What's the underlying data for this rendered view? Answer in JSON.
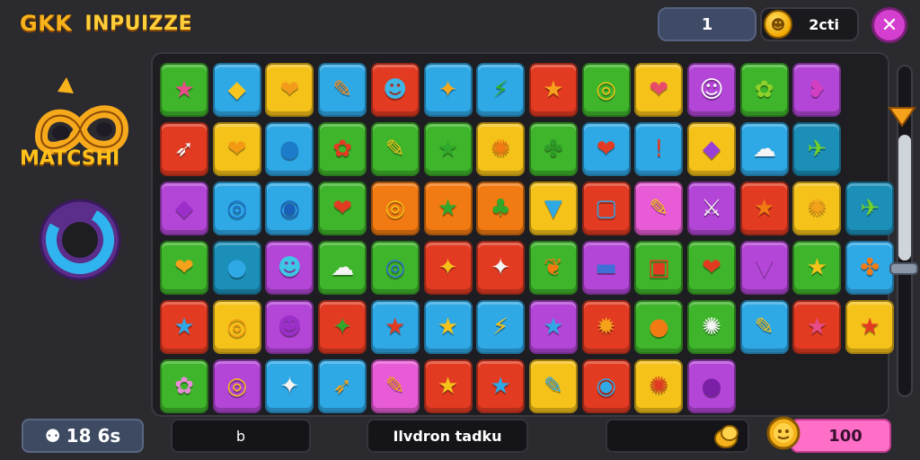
{
  "header": {
    "title_a": "GKK",
    "title_b": "INPUIZZE",
    "moves_value": "1",
    "coins_value": "2cti",
    "close_label": "✕"
  },
  "sidebar": {
    "logo_text": "MATCSHI"
  },
  "bottom": {
    "stats_value": "18 6s",
    "field_1": "b",
    "field_2": "Ilvdron tadku",
    "field_3": "",
    "reward_value": "100"
  },
  "colors": {
    "green": "#3fb52b",
    "blue": "#2fa8e6",
    "yellow": "#f5c21a",
    "red": "#e23b22",
    "orange": "#f27a12",
    "purple": "#b346d6",
    "pink": "#e85bd6",
    "teal": "#1c8fb8"
  },
  "board": {
    "rows": [
      [
        {
          "color": "green",
          "icon": "★",
          "glyph_color": "#e84b8a"
        },
        {
          "color": "blue",
          "icon": "◆",
          "glyph_color": "#f6c51f"
        },
        {
          "color": "yellow",
          "icon": "❤",
          "glyph_color": "#f39c1c"
        },
        {
          "color": "blue",
          "icon": "✎",
          "glyph_color": "#f48a1c"
        },
        {
          "color": "red",
          "icon": "☻",
          "glyph_color": "#3fb6e6"
        },
        {
          "color": "blue",
          "icon": "✦",
          "glyph_color": "#f5a81c"
        },
        {
          "color": "blue",
          "icon": "⚡",
          "glyph_color": "#2fb52b"
        },
        {
          "color": "red",
          "icon": "★",
          "glyph_color": "#f7a21c"
        },
        {
          "color": "green",
          "icon": "◎",
          "glyph_color": "#f5c21a"
        },
        {
          "color": "yellow",
          "icon": "❤",
          "glyph_color": "#e84b6a"
        },
        {
          "color": "purple",
          "icon": "☺",
          "glyph_color": "#ffffff"
        },
        {
          "color": "green",
          "icon": "✿",
          "glyph_color": "#8fd12a"
        },
        {
          "color": "purple",
          "icon": "❥",
          "glyph_color": "#d23fc2"
        }
      ],
      [
        {
          "color": "red",
          "icon": "➶",
          "glyph_color": "#f4f4f4"
        },
        {
          "color": "yellow",
          "icon": "❤",
          "glyph_color": "#f29a12"
        },
        {
          "color": "blue",
          "icon": "●",
          "glyph_color": "#1c7cc9"
        },
        {
          "color": "green",
          "icon": "✿",
          "glyph_color": "#e23b22"
        },
        {
          "color": "green",
          "icon": "✎",
          "glyph_color": "#f5c21a"
        },
        {
          "color": "green",
          "icon": "★",
          "glyph_color": "#2fa82b"
        },
        {
          "color": "yellow",
          "icon": "✺",
          "glyph_color": "#f27a12"
        },
        {
          "color": "green",
          "icon": "✤",
          "glyph_color": "#2e9a27"
        },
        {
          "color": "blue",
          "icon": "❤",
          "glyph_color": "#e23b22"
        },
        {
          "color": "blue",
          "icon": "ǃ",
          "glyph_color": "#e23b22"
        },
        {
          "color": "yellow",
          "icon": "◆",
          "glyph_color": "#9a3fd6"
        },
        {
          "color": "blue",
          "icon": "☁",
          "glyph_color": "#f4f4f4"
        },
        {
          "color": "teal",
          "icon": "✈",
          "glyph_color": "#6fd12a"
        }
      ],
      [
        {
          "color": "purple",
          "icon": "◆",
          "glyph_color": "#9a2fc9"
        },
        {
          "color": "blue",
          "icon": "◎",
          "glyph_color": "#1c6fc9"
        },
        {
          "color": "blue",
          "icon": "◉",
          "glyph_color": "#1c5fb8"
        },
        {
          "color": "green",
          "icon": "❤",
          "glyph_color": "#e23b22"
        },
        {
          "color": "orange",
          "icon": "◎",
          "glyph_color": "#f5c21a"
        },
        {
          "color": "orange",
          "icon": "★",
          "glyph_color": "#2fa82b"
        },
        {
          "color": "orange",
          "icon": "♣",
          "glyph_color": "#2fa82b"
        },
        {
          "color": "yellow",
          "icon": "▼",
          "glyph_color": "#2fa8e6"
        },
        {
          "color": "red",
          "icon": "▢",
          "glyph_color": "#2fa8e6"
        },
        {
          "color": "pink",
          "icon": "✎",
          "glyph_color": "#f5c21a"
        },
        {
          "color": "purple",
          "icon": "⚔",
          "glyph_color": "#f4f4f4"
        },
        {
          "color": "red",
          "icon": "★",
          "glyph_color": "#f27a12"
        },
        {
          "color": "yellow",
          "icon": "✺",
          "glyph_color": "#f5a21a"
        },
        {
          "color": "teal",
          "icon": "✈",
          "glyph_color": "#6fd12a"
        }
      ],
      [
        {
          "color": "green",
          "icon": "❤",
          "glyph_color": "#f5a21a"
        },
        {
          "color": "teal",
          "icon": "●",
          "glyph_color": "#2fa8e6"
        },
        {
          "color": "purple",
          "icon": "☻",
          "glyph_color": "#3fc6e6"
        },
        {
          "color": "green",
          "icon": "☁",
          "glyph_color": "#f4f4f4"
        },
        {
          "color": "green",
          "icon": "◎",
          "glyph_color": "#2f6fd6"
        },
        {
          "color": "red",
          "icon": "✦",
          "glyph_color": "#f5c21a"
        },
        {
          "color": "red",
          "icon": "✦",
          "glyph_color": "#f4f4f4"
        },
        {
          "color": "green",
          "icon": "❦",
          "glyph_color": "#f27a12"
        },
        {
          "color": "purple",
          "icon": "▬",
          "glyph_color": "#3f6fd6"
        },
        {
          "color": "green",
          "icon": "▣",
          "glyph_color": "#e23b22"
        },
        {
          "color": "green",
          "icon": "❤",
          "glyph_color": "#e23b22"
        },
        {
          "color": "purple",
          "icon": "▼",
          "glyph_color": "#b346d6"
        },
        {
          "color": "green",
          "icon": "★",
          "glyph_color": "#f5c21a"
        },
        {
          "color": "blue",
          "icon": "✤",
          "glyph_color": "#f27a12"
        }
      ],
      [
        {
          "color": "red",
          "icon": "★",
          "glyph_color": "#2fa8e6"
        },
        {
          "color": "yellow",
          "icon": "◎",
          "glyph_color": "#f29a12"
        },
        {
          "color": "purple",
          "icon": "☻",
          "glyph_color": "#9a2fc9"
        },
        {
          "color": "red",
          "icon": "✦",
          "glyph_color": "#2fa82b"
        },
        {
          "color": "blue",
          "icon": "★",
          "glyph_color": "#e23b22"
        },
        {
          "color": "blue",
          "icon": "★",
          "glyph_color": "#f5c21a"
        },
        {
          "color": "blue",
          "icon": "⚡",
          "glyph_color": "#f5c21a"
        },
        {
          "color": "purple",
          "icon": "★",
          "glyph_color": "#2fa8e6"
        },
        {
          "color": "red",
          "icon": "✹",
          "glyph_color": "#f5a21a"
        },
        {
          "color": "green",
          "icon": "●",
          "glyph_color": "#f27a12"
        },
        {
          "color": "green",
          "icon": "✺",
          "glyph_color": "#f4f4f4"
        },
        {
          "color": "blue",
          "icon": "✎",
          "glyph_color": "#f5c21a"
        },
        {
          "color": "red",
          "icon": "★",
          "glyph_color": "#e84b8a"
        },
        {
          "color": "yellow",
          "icon": "★",
          "glyph_color": "#e23b22"
        }
      ],
      [
        {
          "color": "green",
          "icon": "✿",
          "glyph_color": "#e88bd6"
        },
        {
          "color": "purple",
          "icon": "◎",
          "glyph_color": "#f5c21a"
        },
        {
          "color": "blue",
          "icon": "✦",
          "glyph_color": "#f4f4f4"
        },
        {
          "color": "blue",
          "icon": "➶",
          "glyph_color": "#f5a21a"
        },
        {
          "color": "pink",
          "icon": "✎",
          "glyph_color": "#f5a21a"
        },
        {
          "color": "red",
          "icon": "★",
          "glyph_color": "#f5c21a"
        },
        {
          "color": "red",
          "icon": "★",
          "glyph_color": "#2fa8e6"
        },
        {
          "color": "yellow",
          "icon": "✎",
          "glyph_color": "#2fa8e6"
        },
        {
          "color": "red",
          "icon": "◉",
          "glyph_color": "#2fa8e6"
        },
        {
          "color": "yellow",
          "icon": "✺",
          "glyph_color": "#e23b22"
        },
        {
          "color": "purple",
          "icon": "●",
          "glyph_color": "#7a1fa6"
        }
      ]
    ]
  }
}
